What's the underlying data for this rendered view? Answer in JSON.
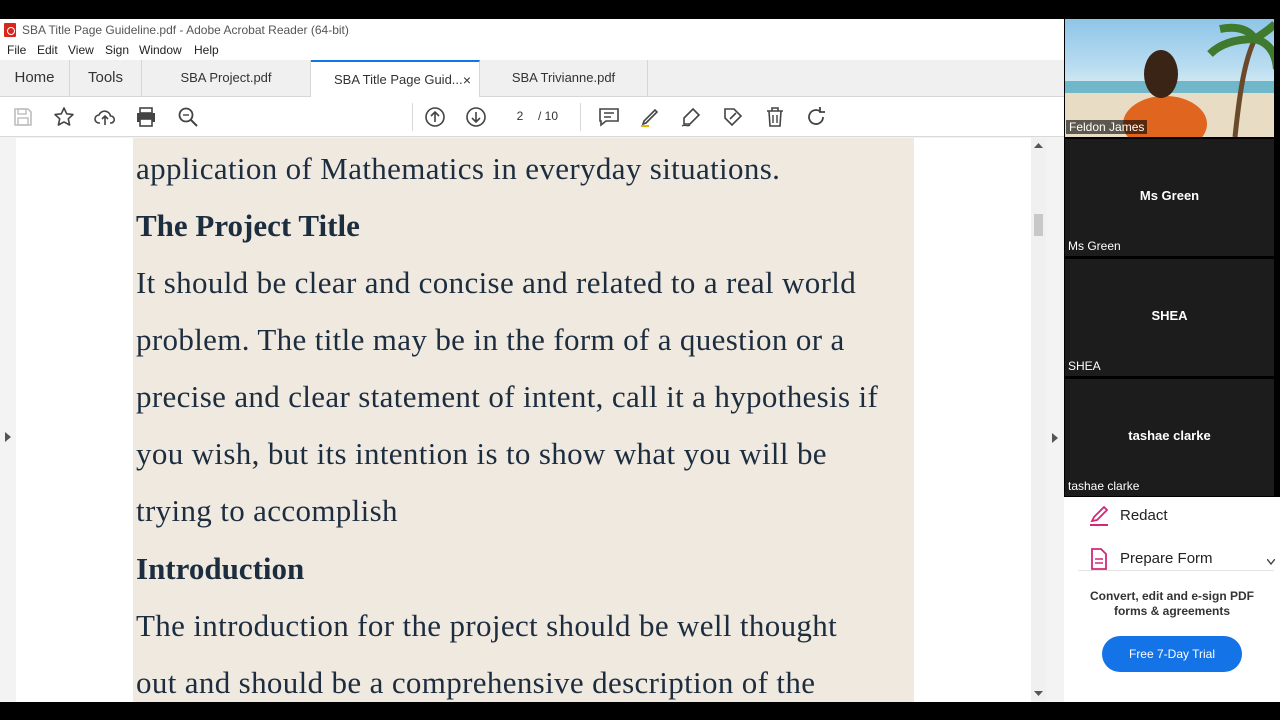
{
  "window": {
    "title": "SBA Title Page Guideline.pdf - Adobe Acrobat Reader (64-bit)"
  },
  "menu": [
    "File",
    "Edit",
    "View",
    "Sign",
    "Window",
    "Help"
  ],
  "tabs": {
    "home": "Home",
    "tools": "Tools",
    "doc1": "SBA Project.pdf",
    "doc2": "SBA Title Page Guid...",
    "doc3": "SBA Trivianne.pdf",
    "close": "×"
  },
  "toolbar": {
    "page_current": "2",
    "page_total": "/ 10"
  },
  "document": {
    "line1": "application of Mathematics in everyday situations.",
    "heading1": "The Project Title",
    "para1": [
      "It should be clear and concise and related to a real world",
      "problem. The title may be in the form of a question or a",
      "precise and clear statement of intent, call it a hypothesis if",
      "you wish, but its intention is to show what you will be",
      "trying to accomplish"
    ],
    "heading2": "Introduction",
    "para2": [
      "The introduction for the project should be well thought",
      "out and should be a comprehensive description of the"
    ]
  },
  "participants": {
    "p1": "Feldon James",
    "p2": "Ms Green",
    "p3": "SHEA",
    "p4": "tashae clarke"
  },
  "tools_panel": {
    "redact": "Redact",
    "prepare_form": "Prepare Form",
    "promo_line1": "Convert, edit and e-sign PDF",
    "promo_line2": "forms & agreements",
    "trial_button": "Free 7-Day Trial"
  },
  "colors": {
    "accent": "#1473e6",
    "page_bg": "#efe9df",
    "text": "#1d2d40",
    "redact_icon": "#d2287a"
  }
}
